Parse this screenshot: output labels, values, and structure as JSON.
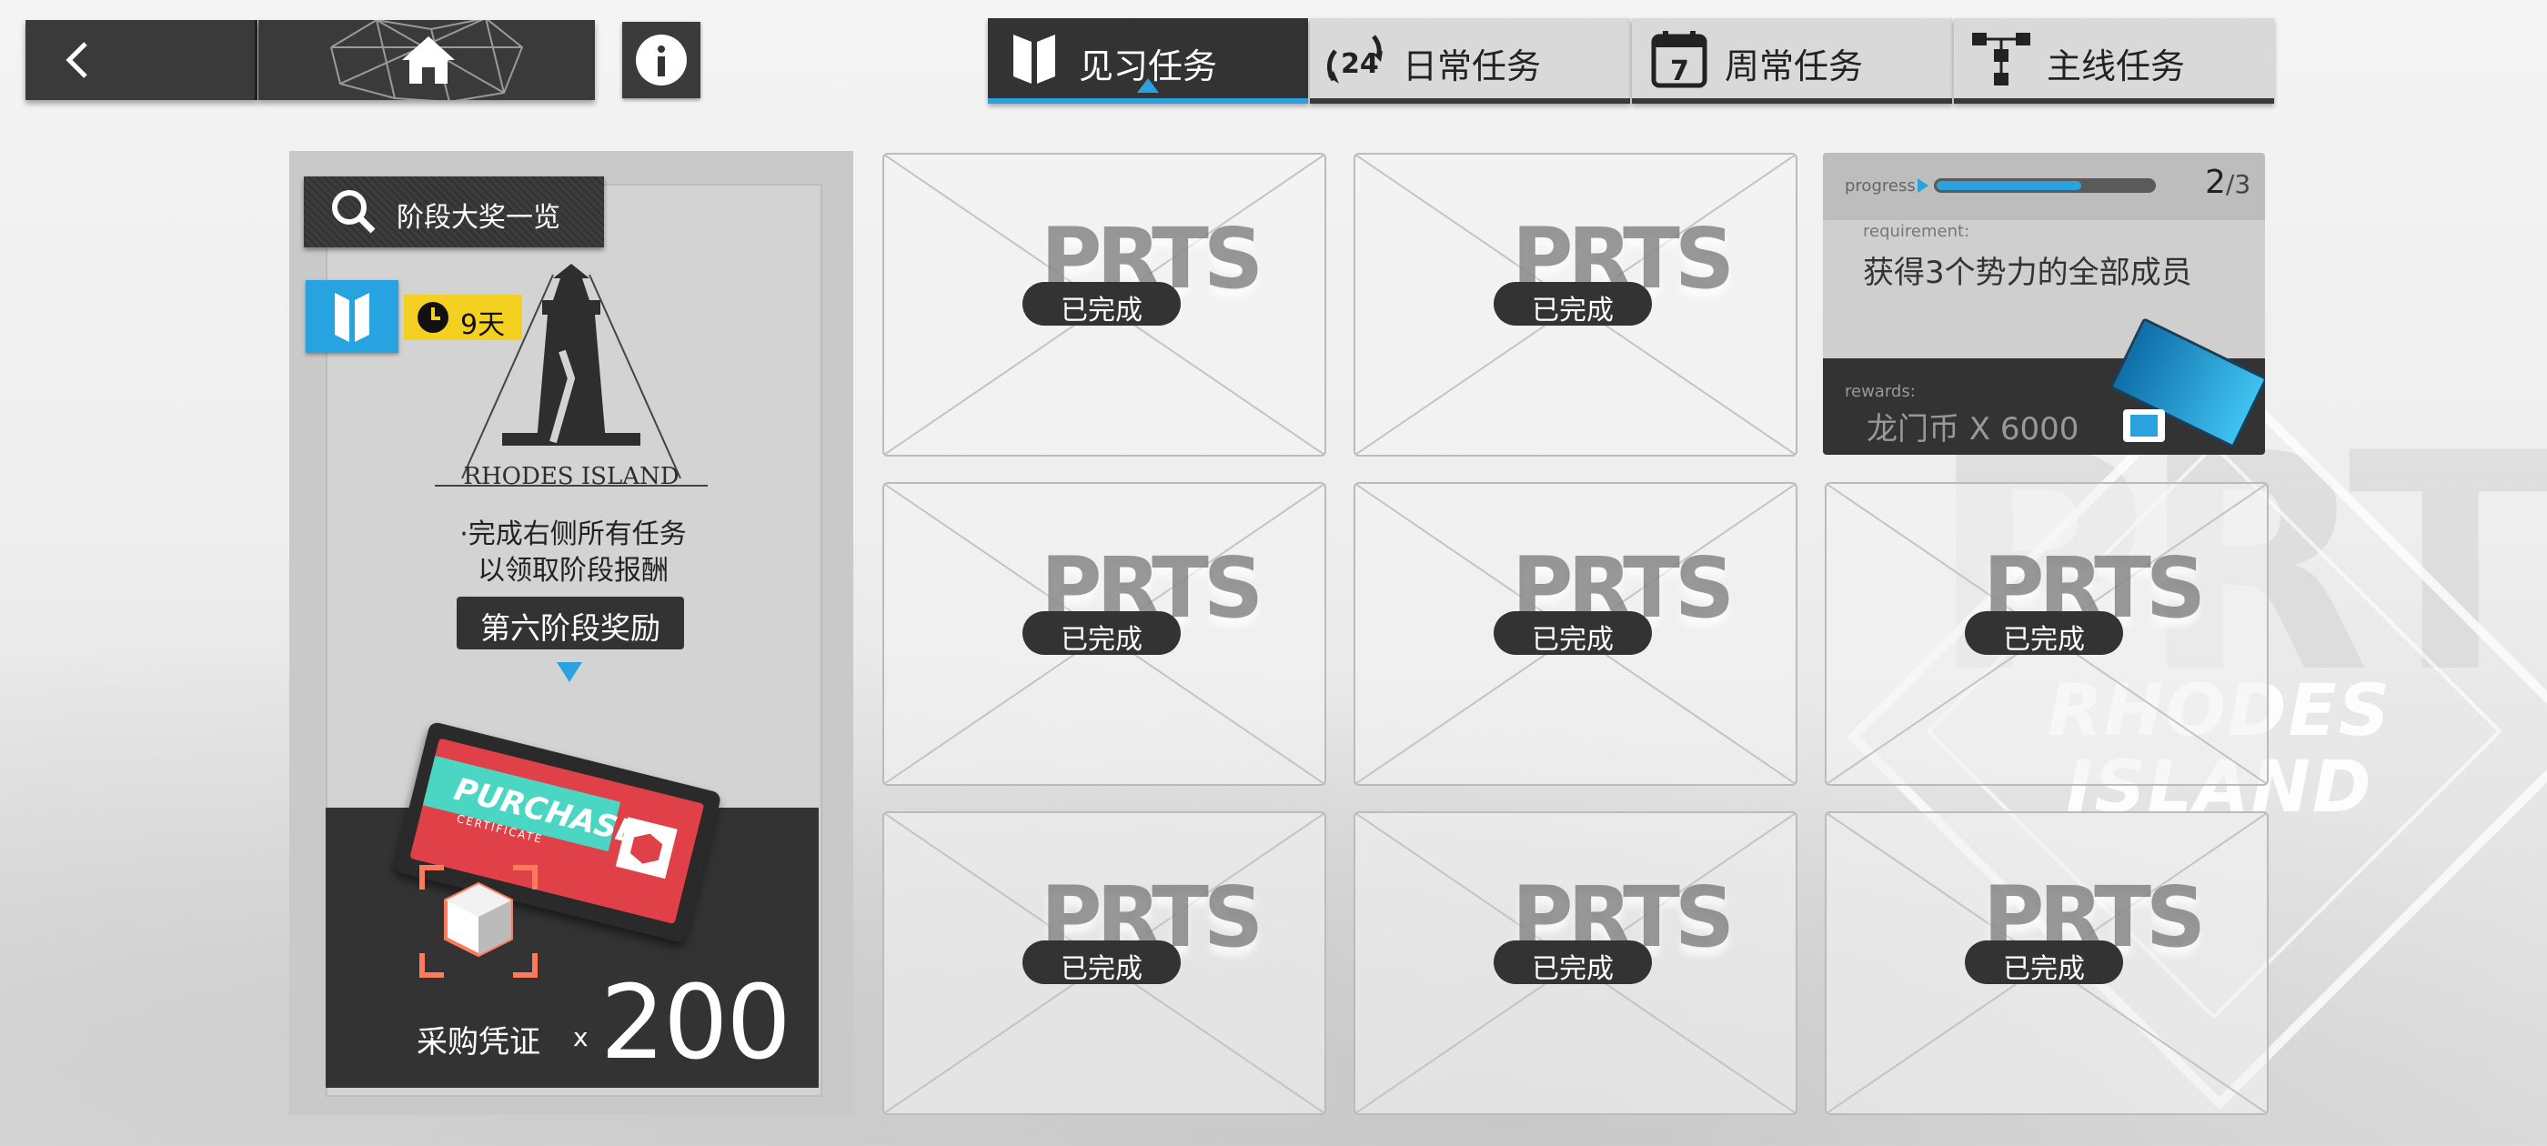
{
  "nav": {
    "back_icon": "chevron-left-icon",
    "home_icon": "home-icon",
    "info_icon": "info-icon"
  },
  "tabs": [
    {
      "label": "见习任务",
      "icon": "shield-book-icon",
      "active": true
    },
    {
      "label": "日常任务",
      "icon": "24h-refresh-icon",
      "active": false
    },
    {
      "label": "周常任务",
      "icon": "calendar-7-icon",
      "active": false
    },
    {
      "label": "主线任务",
      "icon": "tree-flow-icon",
      "active": false
    }
  ],
  "left_panel": {
    "search_label": "阶段大奖一览",
    "timer": "9天",
    "logo_text": "RHODES ISLAND",
    "description_line1": "·完成右侧所有任务",
    "description_line2": "以领取阶段报酬",
    "stage_label": "第六阶段奖励",
    "ticket_title": "PURCHASE",
    "ticket_subtitle": "CERTIFICATE",
    "reward_name": "采购凭证",
    "reward_x": "x",
    "reward_amount": "200"
  },
  "active_task": {
    "progress_label": "progress",
    "progress_current": "2",
    "progress_total": "/3",
    "progress_fraction": 0.667,
    "requirement_label": "requirement:",
    "requirement": "获得3个势力的全部成员",
    "rewards_label": "rewards:",
    "reward": "龙门币 X 6000"
  },
  "tasks": [
    {
      "status": "已完成",
      "watermark": "PRTS"
    },
    {
      "status": "已完成",
      "watermark": "PRTS"
    },
    {
      "status": "已完成",
      "watermark": "PRTS"
    },
    {
      "status": "已完成",
      "watermark": "PRTS"
    },
    {
      "status": "已完成",
      "watermark": "PRTS"
    },
    {
      "status": "已完成",
      "watermark": "PRTS"
    },
    {
      "status": "已完成",
      "watermark": "PRTS"
    },
    {
      "status": "已完成",
      "watermark": "PRTS"
    }
  ],
  "background": {
    "watermark": "PRTS",
    "brand_line1": "RHODES",
    "brand_line2": "ISLAND"
  },
  "colors": {
    "accent_blue": "#2aa2e0",
    "dark": "#333333",
    "timer_yellow": "#f4d120",
    "ticket_red": "#e04048"
  }
}
